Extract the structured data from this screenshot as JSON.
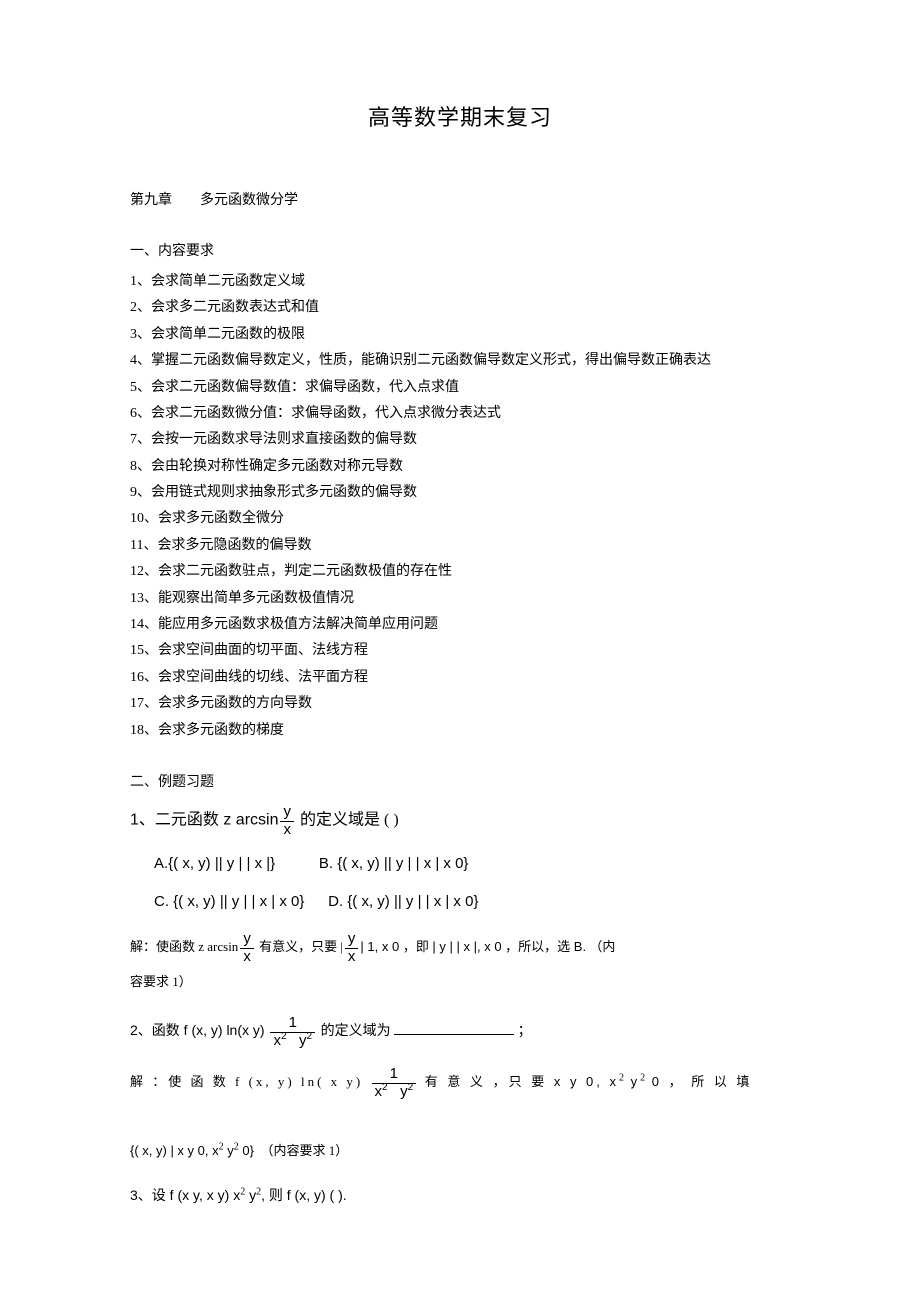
{
  "title": "高等数学期末复习",
  "chapter_num": "第九章",
  "chapter_name": "多元函数微分学",
  "reqs_head": "一、内容要求",
  "reqs": [
    "1、会求简单二元函数定义域",
    "2、会求多二元函数表达式和值",
    "3、会求简单二元函数的极限",
    "4、掌握二元函数偏导数定义，性质，能确识别二元函数偏导数定义形式，得出偏导数正确表达",
    "5、会求二元函数偏导数值：求偏导函数，代入点求值",
    "6、会求二元函数微分值：求偏导函数，代入点求微分表达式",
    "7、会按一元函数求导法则求直接函数的偏导数",
    "8、会由轮换对称性确定多元函数对称元导数",
    "9、会用链式规则求抽象形式多元函数的偏导数",
    "10、会求多元函数全微分",
    "11、会求多元隐函数的偏导数",
    "12、会求二元函数驻点，判定二元函数极值的存在性",
    "13、能观察出简单多元函数极值情况",
    "14、能应用多元函数求极值方法解决简单应用问题",
    "15、会求空间曲面的切平面、法线方程",
    "16、会求空间曲线的切线、法平面方程",
    "17、会求多元函数的方向导数",
    "18、会求多元函数的梯度"
  ],
  "ex_head": "二、例题习题",
  "q1_pre": "1、二元函数 z   arcsin",
  "q1_frac_num": "y",
  "q1_frac_den": "x",
  "q1_post": " 的定义域是 (        )",
  "q1_optA": "A.{( x, y) || y |  | x |}",
  "q1_optB": "B.  {( x, y) || y |  | x | x     0}",
  "q1_optC": "C.  {( x, y) || y |  | x | x    0}",
  "q1_optD": "D.  {( x, y) || y |  | x | x     0}",
  "sol1_a": "解：使函数  z    arcsin",
  "sol1_b": " 有意义，只要   |",
  "sol1_c": "|   1, x    0 ，即 | y |  | x |, x    0 ，所以，选   B.",
  "sol1_d": "（内",
  "sol1_e": "容要求  1）",
  "q2_a": "2、函数  f (x, y)    ln(x    y)   ",
  "q2_b": " 的定义域为  ",
  "q2_c": " ；",
  "q2_frac_num": "1",
  "q2_frac_den1": "x",
  "q2_frac_den2": "y",
  "sol2_a": "解 ：使 函 数  f (x, y)    ln( x    y)    ",
  "sol2_b": " 有 意 义 ，只 要  x    y    0, x",
  "sol2_c": "    y",
  "sol2_d": "    0 ， 所 以 填",
  "sol2_e": "{( x, y) | x    y    0, x",
  "sol2_f": "    y",
  "sol2_g": "    0}",
  "sol2_h": "（内容要求   1）",
  "q3_a": "3、设 f (x    y, x    y)    x",
  "q3_b": "    y",
  "q3_c": ", 则  f (x, y)    (          )."
}
